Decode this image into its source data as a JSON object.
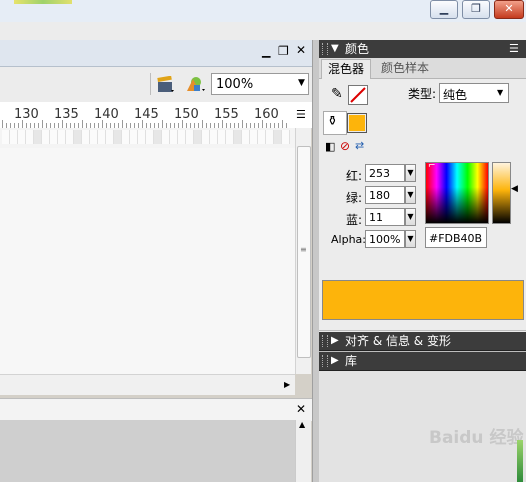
{
  "window": {
    "minimize_icon": "minimize-icon",
    "restore_icon": "restore-icon",
    "close_icon": "close-icon"
  },
  "document": {
    "zoom": "100%",
    "ruler_numbers": [
      "130",
      "135",
      "140",
      "145",
      "150",
      "155",
      "160"
    ]
  },
  "color_panel": {
    "title": "颜色",
    "tabs": [
      "混色器",
      "颜色样本"
    ],
    "type_label": "类型:",
    "type_value": "纯色",
    "red_label": "红:",
    "red_value": "253",
    "green_label": "绿:",
    "green_value": "180",
    "blue_label": "蓝:",
    "blue_value": "11",
    "alpha_label": "Alpha:",
    "alpha_value": "100%",
    "hex_value": "#FDB40B",
    "current_color": "#FDB40B"
  },
  "align_panel": {
    "title": "对齐 & 信息 & 变形"
  },
  "library_panel": {
    "title": "库"
  },
  "watermark": "Baidu 经验"
}
